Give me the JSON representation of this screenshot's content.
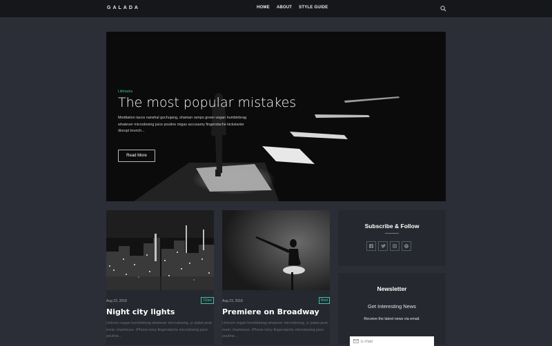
{
  "site": {
    "logo": "GALADA",
    "nav": [
      "HOME",
      "ABOUT",
      "STYLE GUIDE"
    ]
  },
  "hero": {
    "category": "Lifehacks",
    "title": "The most popular mistakes",
    "excerpt": "Meditation tacos narwhal gochujang, shaman ramps green vegan humblebrag whatever microdosing juice poutine migas accusamy fingerstache kickstarter disrupt brunch...",
    "button": "Read More"
  },
  "cards": [
    {
      "date": "Aug 23, 2018",
      "tag": "Cities",
      "title": "Night city lights",
      "excerpt": "Unicorn vegan humblebrag whatever microdosing, yr pabst post-ironic chartreuse. IPhone irony fingerstache microdosing juice poutine..."
    },
    {
      "date": "Aug 23, 2018",
      "tag": "Rest",
      "title": "Premiere on Broadway",
      "excerpt": "Unicorn vegan humblebrag whatever microdosing, yr pabst post-ironic chartreuse. IPhone irony fingerstache microdosing juice poutine..."
    }
  ],
  "sidebar": {
    "subscribe_title": "Subscribe & Follow",
    "socials": [
      "facebook-icon",
      "twitter-icon",
      "instagram-icon",
      "pinterest-icon"
    ],
    "newsletter": {
      "title": "Newsletter",
      "subtitle": "Get Interesting News",
      "description": "Receive the latest news via email.",
      "placeholder": "E-mail"
    }
  },
  "colors": {
    "background": "#2b2e36",
    "topbar": "#16171a",
    "accent": "#3fc3a7",
    "card": "#25282f"
  }
}
